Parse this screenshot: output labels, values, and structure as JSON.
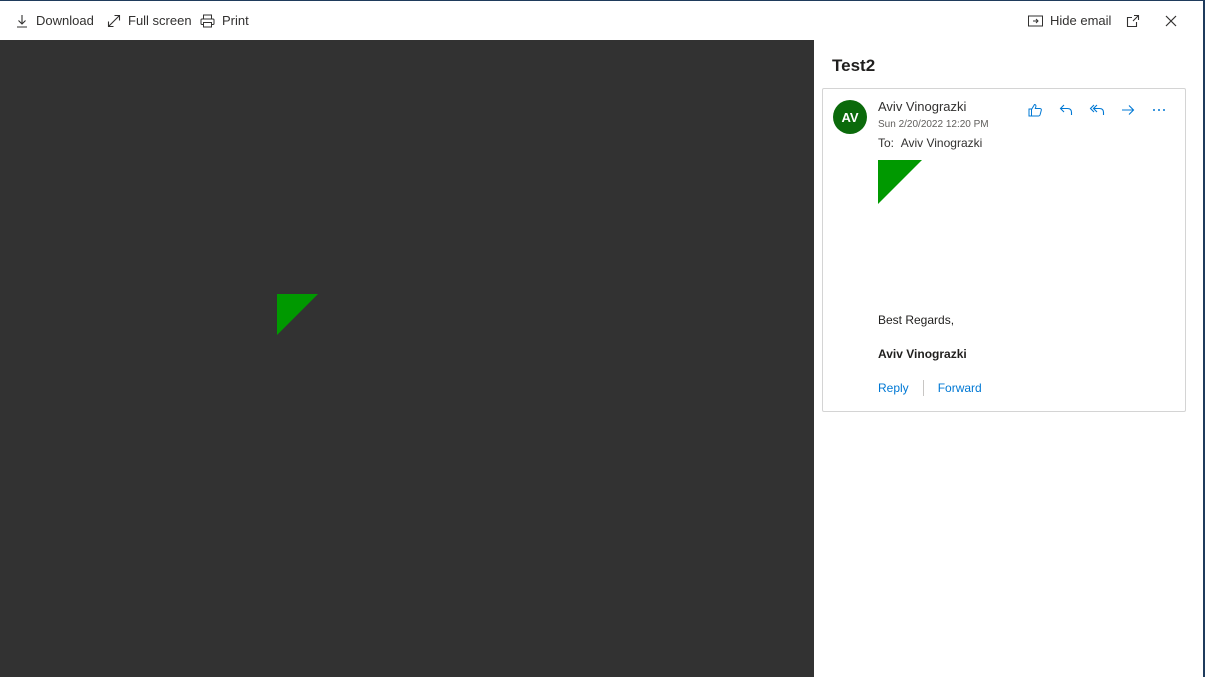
{
  "toolbar": {
    "download_label": "Download",
    "fullscreen_label": "Full screen",
    "print_label": "Print",
    "hide_email_label": "Hide email"
  },
  "icons": {
    "download": "download-icon",
    "fullscreen": "expand-icon",
    "print": "printer-icon",
    "hide_email": "panel-icon",
    "popout": "popout-icon",
    "close": "close-icon",
    "like": "thumbs-up-icon",
    "reply": "reply-icon",
    "reply_all": "reply-all-icon",
    "forward": "forward-icon",
    "more": "more-icon"
  },
  "colors": {
    "viewer_bg": "#323232",
    "accent": "#0078d4",
    "avatar_bg": "#0b6a0b",
    "triangle": "#009900"
  },
  "email": {
    "subject": "Test2",
    "avatar_initials": "AV",
    "sender": "Aviv Vinograzki",
    "date": "Sun 2/20/2022 12:20 PM",
    "to_label": "To:",
    "to_value": "Aviv Vinograzki",
    "closing": "Best Regards,",
    "signature": "Aviv Vinograzki",
    "reply_label": "Reply",
    "forward_label": "Forward"
  }
}
